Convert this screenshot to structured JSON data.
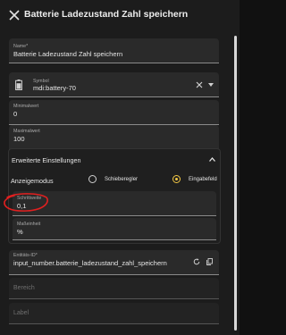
{
  "header": {
    "title": "Batterie Ladezustand Zahl speichern",
    "close_icon": "close-icon"
  },
  "fields": {
    "name": {
      "label": "Name*",
      "value": "Batterie Ladezustand Zahl speichern"
    },
    "symbol": {
      "label": "Symbol",
      "value": "mdi:battery-70",
      "icon": "battery-icon"
    },
    "min": {
      "label": "Minimalwert",
      "value": "0"
    },
    "max": {
      "label": "Maximalwert",
      "value": "100"
    }
  },
  "advanced": {
    "title": "Erweiterte Einstellungen",
    "mode_label": "Anzeigemodus",
    "options": [
      "Schieberegler",
      "Eingabefeld"
    ],
    "selected": "Eingabefeld",
    "step": {
      "label": "Schrittweite",
      "value": "0,1"
    },
    "unit": {
      "label": "Maßeinheit",
      "value": "%"
    }
  },
  "entity": {
    "label": "Entitäts-ID*",
    "value": "input_number.batterie_ladezustand_zahl_speichern"
  },
  "bereich": {
    "placeholder": "Bereich"
  },
  "label_field": {
    "placeholder": "Label"
  },
  "colors": {
    "accent": "#f2c744",
    "annotation": "#e02020",
    "background": "#1c1c1c"
  }
}
